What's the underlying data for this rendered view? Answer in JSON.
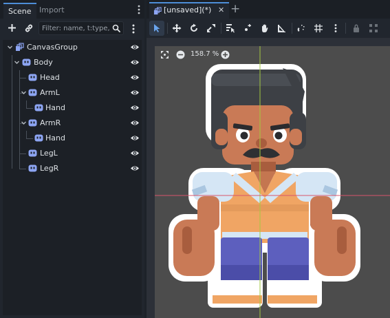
{
  "dock": {
    "tabs": [
      "Scene",
      "Import"
    ],
    "filter_placeholder": "Filter: name, t:type, g:"
  },
  "tree": [
    {
      "label": "CanvasGroup",
      "icon": "canvas-group-icon",
      "depth": 0,
      "expanded": true,
      "visible": true
    },
    {
      "label": "Body",
      "icon": "node2d-icon",
      "depth": 1,
      "expanded": true,
      "visible": true
    },
    {
      "label": "Head",
      "icon": "node2d-icon",
      "depth": 2,
      "visible": true
    },
    {
      "label": "ArmL",
      "icon": "node2d-icon",
      "depth": 2,
      "expanded": true,
      "visible": true
    },
    {
      "label": "Hand",
      "icon": "node2d-icon",
      "depth": 3,
      "visible": true
    },
    {
      "label": "ArmR",
      "icon": "node2d-icon",
      "depth": 2,
      "expanded": true,
      "visible": true
    },
    {
      "label": "Hand",
      "icon": "node2d-icon",
      "depth": 3,
      "visible": true
    },
    {
      "label": "LegL",
      "icon": "node2d-icon",
      "depth": 2,
      "visible": true
    },
    {
      "label": "LegR",
      "icon": "node2d-icon",
      "depth": 2,
      "visible": true
    }
  ],
  "editor": {
    "tab_label": "[unsaved](*)",
    "zoom_label": "158.7 %"
  },
  "colors": {
    "accent": "#4d8ed8",
    "node_icon": "#8da5f3",
    "viewport_bg": "#4c4c4c"
  }
}
